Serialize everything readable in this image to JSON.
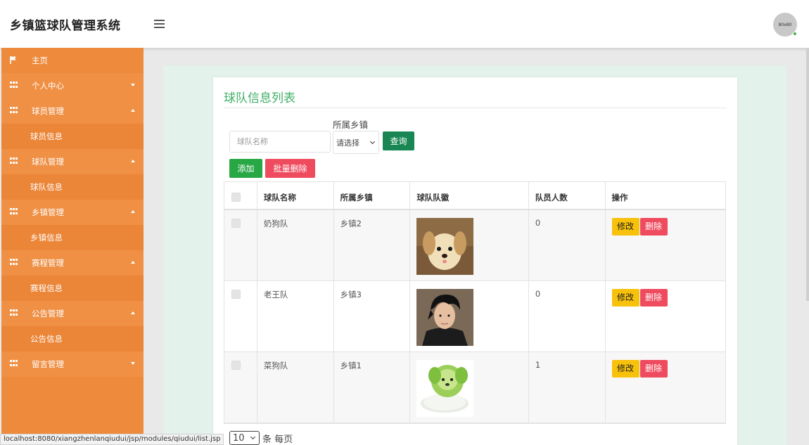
{
  "header": {
    "title": "乡镇篮球队管理系统",
    "avatar_text": "80x80"
  },
  "sidebar": {
    "items": [
      {
        "label": "主页",
        "type": "home"
      },
      {
        "label": "个人中心",
        "type": "group",
        "expanded": false
      },
      {
        "label": "球员管理",
        "type": "group",
        "expanded": true
      },
      {
        "label": "球员信息",
        "type": "sub"
      },
      {
        "label": "球队管理",
        "type": "group",
        "expanded": true
      },
      {
        "label": "球队信息",
        "type": "sub"
      },
      {
        "label": "乡镇管理",
        "type": "group",
        "expanded": true
      },
      {
        "label": "乡镇信息",
        "type": "sub"
      },
      {
        "label": "赛程管理",
        "type": "group",
        "expanded": true
      },
      {
        "label": "赛程信息",
        "type": "sub"
      },
      {
        "label": "公告管理",
        "type": "group",
        "expanded": true
      },
      {
        "label": "公告信息",
        "type": "sub"
      },
      {
        "label": "留言管理",
        "type": "group",
        "expanded": false
      }
    ]
  },
  "main": {
    "title": "球队信息列表",
    "search": {
      "placeholder": "球队名称",
      "town_label": "所属乡镇",
      "town_select_value": "请选择",
      "query_label": "查询"
    },
    "add_label": "添加",
    "batch_delete_label": "批量删除",
    "table": {
      "columns": [
        "球队名称",
        "所属乡镇",
        "球队队徽",
        "队员人数",
        "操作"
      ],
      "rows": [
        {
          "name": "奶狗队",
          "town": "乡镇2",
          "logo": "puppy-image",
          "count": "0"
        },
        {
          "name": "老王队",
          "town": "乡镇3",
          "logo": "portrait-image",
          "count": "0"
        },
        {
          "name": "菜狗队",
          "town": "乡镇1",
          "logo": "cabbage-dog-image",
          "count": "1"
        }
      ],
      "edit_label": "修改",
      "delete_label": "删除"
    },
    "pager": {
      "page_size": "10",
      "suffix": "条 每页"
    }
  },
  "status_bar": {
    "url": "localhost:8080/xiangzhenlanqiudui/jsp/modules/qiudui/list.jsp"
  },
  "colors": {
    "sidebar": "#ee8a3c",
    "accent_green": "#3fae67",
    "delete_red": "#ef4b5e",
    "edit_yellow": "#f8c10b"
  }
}
